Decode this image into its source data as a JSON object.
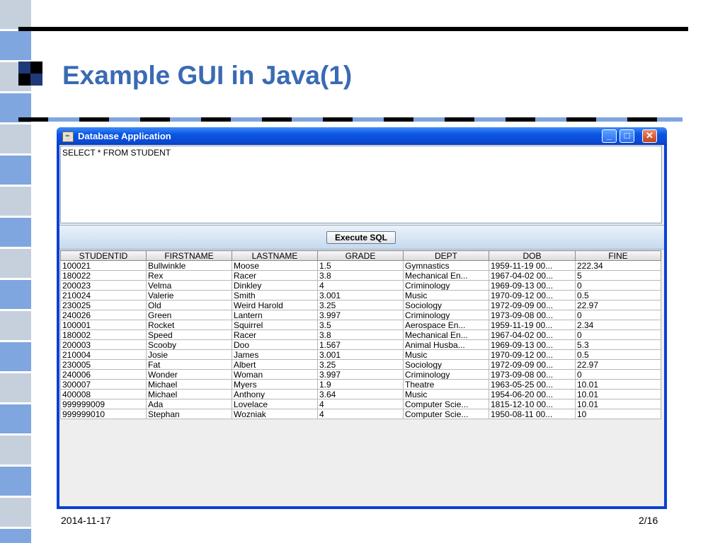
{
  "slide": {
    "title": "Example GUI in Java(1)",
    "date": "2014-11-17",
    "page": "2/16"
  },
  "window": {
    "title": "Database Application",
    "controls": {
      "minimize": "_",
      "maximize": "□",
      "close": "✕"
    }
  },
  "query": {
    "text": "SELECT * FROM STUDENT"
  },
  "execute_button": {
    "label": "Execute SQL"
  },
  "table": {
    "columns": [
      "STUDENTID",
      "FIRSTNAME",
      "LASTNAME",
      "GRADE",
      "DEPT",
      "DOB",
      "FINE"
    ],
    "rows": [
      [
        "100021",
        "Bullwinkle",
        "Moose",
        "1.5",
        "Gymnastics",
        "1959-11-19 00...",
        "222.34"
      ],
      [
        "180022",
        "Rex",
        "Racer",
        "3.8",
        "Mechanical En...",
        "1967-04-02 00...",
        "5"
      ],
      [
        "200023",
        "Velma",
        "Dinkley",
        "4",
        "Criminology",
        "1969-09-13 00...",
        "0"
      ],
      [
        "210024",
        "Valerie",
        "Smith",
        "3.001",
        "Music",
        "1970-09-12 00...",
        "0.5"
      ],
      [
        "230025",
        "Old",
        "Weird Harold",
        "3.25",
        "Sociology",
        "1972-09-09 00...",
        "22.97"
      ],
      [
        "240026",
        "Green",
        "Lantern",
        "3.997",
        "Criminology",
        "1973-09-08 00...",
        "0"
      ],
      [
        "100001",
        "Rocket",
        "Squirrel",
        "3.5",
        "Aerospace En...",
        "1959-11-19 00...",
        "2.34"
      ],
      [
        "180002",
        "Speed",
        "Racer",
        "3.8",
        "Mechanical En...",
        "1967-04-02 00...",
        "0"
      ],
      [
        "200003",
        "Scooby",
        "Doo",
        "1.567",
        "Animal Husba...",
        "1969-09-13 00...",
        "5.3"
      ],
      [
        "210004",
        "Josie",
        "James",
        "3.001",
        "Music",
        "1970-09-12 00...",
        "0.5"
      ],
      [
        "230005",
        "Fat",
        "Albert",
        "3.25",
        "Sociology",
        "1972-09-09 00...",
        "22.97"
      ],
      [
        "240006",
        "Wonder",
        "Woman",
        "3.997",
        "Criminology",
        "1973-09-08 00...",
        "0"
      ],
      [
        "300007",
        "Michael",
        "Myers",
        "1.9",
        "Theatre",
        "1963-05-25 00...",
        "10.01"
      ],
      [
        "400008",
        "Michael",
        "Anthony",
        "3.64",
        "Music",
        "1954-06-20 00...",
        "10.01"
      ],
      [
        "999999009",
        "Ada",
        "Lovelace",
        "4",
        "Computer Scie...",
        "1815-12-10 00...",
        "10.01"
      ],
      [
        "999999010",
        "Stephan",
        "Wozniak",
        "4",
        "Computer Scie...",
        "1950-08-11 00...",
        "10"
      ]
    ]
  },
  "colors": {
    "title": "#3a6ab4",
    "window_frame": "#0a3fd6",
    "strip_blue": "#7fa6de"
  }
}
